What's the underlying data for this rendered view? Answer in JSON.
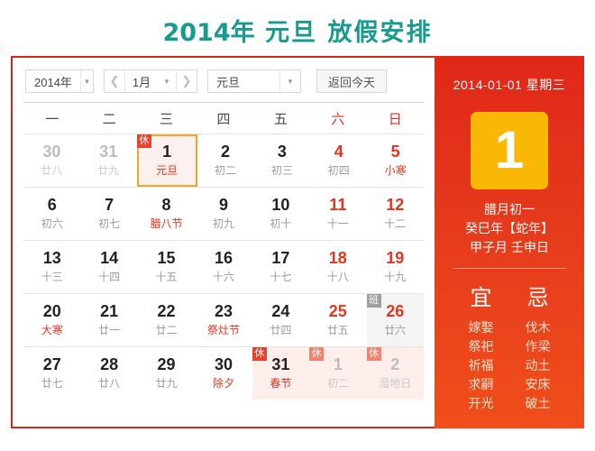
{
  "title": {
    "year": "2014年",
    "festival": "元旦",
    "suffix": "放假安排",
    "color": "#179b8e"
  },
  "toolbar": {
    "year_value": "2014年",
    "prev_icon": "chevron-left-icon",
    "month_value": "1月",
    "next_icon": "chevron-right-icon",
    "holiday_value": "元旦",
    "today_label": "返回今天",
    "caret_icon": "chevron-down-icon"
  },
  "calendar": {
    "weekdays": [
      {
        "label": "一",
        "weekend": false
      },
      {
        "label": "二",
        "weekend": false
      },
      {
        "label": "三",
        "weekend": false
      },
      {
        "label": "四",
        "weekend": false
      },
      {
        "label": "五",
        "weekend": false
      },
      {
        "label": "六",
        "weekend": true
      },
      {
        "label": "日",
        "weekend": true
      }
    ],
    "rows": [
      [
        {
          "num": "30",
          "sub": "廿八",
          "muted": true
        },
        {
          "num": "31",
          "sub": "廿九",
          "muted": true
        },
        {
          "num": "1",
          "sub": "元旦",
          "festival": true,
          "selected": true,
          "badge": "休",
          "badge_type": "rest"
        },
        {
          "num": "2",
          "sub": "初二"
        },
        {
          "num": "3",
          "sub": "初三"
        },
        {
          "num": "4",
          "sub": "初四",
          "red": true
        },
        {
          "num": "5",
          "sub": "小寒",
          "red": true,
          "festival": true
        }
      ],
      [
        {
          "num": "6",
          "sub": "初六"
        },
        {
          "num": "7",
          "sub": "初七"
        },
        {
          "num": "8",
          "sub": "腊八节",
          "festival": true
        },
        {
          "num": "9",
          "sub": "初九"
        },
        {
          "num": "10",
          "sub": "初十"
        },
        {
          "num": "11",
          "sub": "十一",
          "red": true
        },
        {
          "num": "12",
          "sub": "十二",
          "red": true
        }
      ],
      [
        {
          "num": "13",
          "sub": "十三"
        },
        {
          "num": "14",
          "sub": "十四"
        },
        {
          "num": "15",
          "sub": "十五"
        },
        {
          "num": "16",
          "sub": "十六"
        },
        {
          "num": "17",
          "sub": "十七"
        },
        {
          "num": "18",
          "sub": "十八",
          "red": true
        },
        {
          "num": "19",
          "sub": "十九",
          "red": true
        }
      ],
      [
        {
          "num": "20",
          "sub": "大寒",
          "festival": true
        },
        {
          "num": "21",
          "sub": "廿一"
        },
        {
          "num": "22",
          "sub": "廿二"
        },
        {
          "num": "23",
          "sub": "祭灶节",
          "festival": true
        },
        {
          "num": "24",
          "sub": "廿四"
        },
        {
          "num": "25",
          "sub": "廿五",
          "red": true
        },
        {
          "num": "26",
          "sub": "廿六",
          "red": true,
          "badge": "班",
          "badge_type": "work",
          "bg": "gray"
        }
      ],
      [
        {
          "num": "27",
          "sub": "廿七"
        },
        {
          "num": "28",
          "sub": "廿八"
        },
        {
          "num": "29",
          "sub": "廿九"
        },
        {
          "num": "30",
          "sub": "除夕",
          "festival": true
        },
        {
          "num": "31",
          "sub": "春节",
          "festival": true,
          "badge": "休",
          "badge_type": "rest",
          "bg": "pink"
        },
        {
          "num": "1",
          "sub": "初二",
          "muted": true,
          "badge": "休",
          "badge_type": "rest-faded",
          "bg": "pink"
        },
        {
          "num": "2",
          "sub": "湿地日",
          "muted": true,
          "badge": "休",
          "badge_type": "rest-faded",
          "bg": "pink"
        }
      ]
    ]
  },
  "detail": {
    "date_line": "2014-01-01 星期三",
    "day_number": "1",
    "lunar_day": "腊月初一",
    "lunar_year": "癸巳年【蛇年】",
    "lunar_month_day": "甲子月 壬申日",
    "yi_head": "宜",
    "ji_head": "忌",
    "yi_items": [
      "嫁娶",
      "祭祀",
      "祈福",
      "求嗣",
      "开光"
    ],
    "ji_items": [
      "伐木",
      "作梁",
      "动土",
      "安床",
      "破土"
    ],
    "accent_day_bg": "#f9b805",
    "panel_bg": "#e02718"
  }
}
